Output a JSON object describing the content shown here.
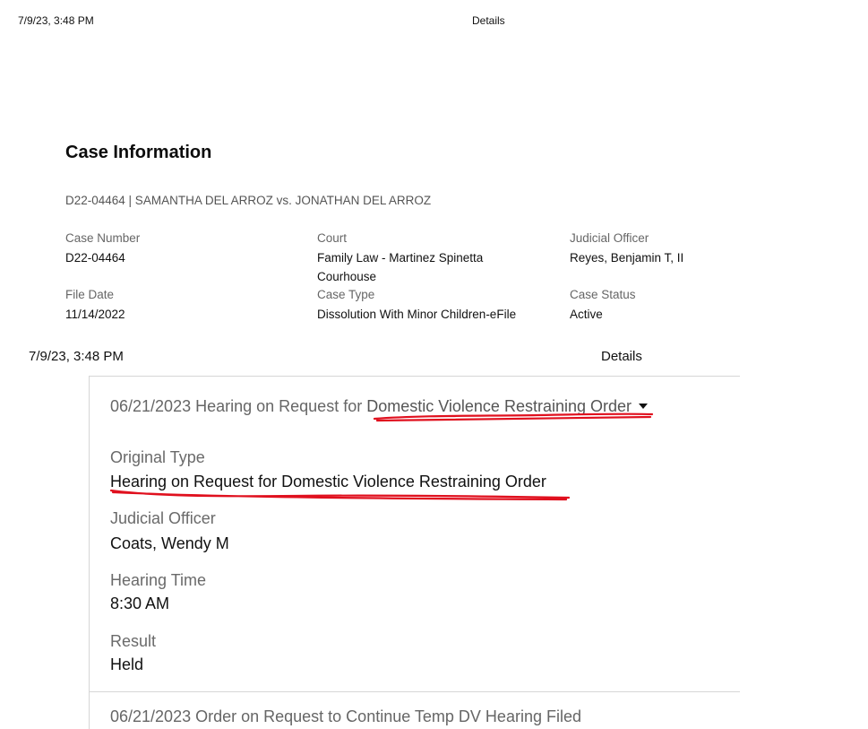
{
  "print_header_1": {
    "date": "7/9/23, 3:48 PM",
    "title": "Details"
  },
  "case": {
    "heading": "Case Information",
    "caption": "D22-04464 | SAMANTHA DEL ARROZ vs. JONATHAN DEL ARROZ",
    "fields": {
      "case_number": {
        "label": "Case Number",
        "value": "D22-04464"
      },
      "court": {
        "label": "Court",
        "value_line1": "Family Law - Martinez Spinetta",
        "value_line2": "Courhouse"
      },
      "judicial_officer": {
        "label": "Judicial Officer",
        "value": "Reyes, Benjamin T, II"
      },
      "file_date": {
        "label": "File Date",
        "value": "11/14/2022"
      },
      "case_type": {
        "label": "Case Type",
        "value": "Dissolution With Minor Children-eFile"
      },
      "case_status": {
        "label": "Case Status",
        "value": "Active"
      }
    }
  },
  "print_header_2": {
    "date": "7/9/23, 3:48 PM",
    "title": "Details"
  },
  "hearing": {
    "header_prefix": "06/21/2023 Hearing on Request for ",
    "header_link": "Domestic Violence Restraining Order",
    "original_type": {
      "label": "Original Type",
      "value": "Hearing on Request for Domestic Violence Restraining Order"
    },
    "judicial_officer": {
      "label": "Judicial Officer",
      "value": "Coats, Wendy M"
    },
    "hearing_time": {
      "label": "Hearing Time",
      "value": "8:30 AM"
    },
    "result": {
      "label": "Result",
      "value": "Held"
    }
  },
  "next_event": {
    "header": "06/21/2023 Order on Request to Continue Temp DV Hearing Filed"
  },
  "colors": {
    "annotation_red": "#e0101e"
  }
}
